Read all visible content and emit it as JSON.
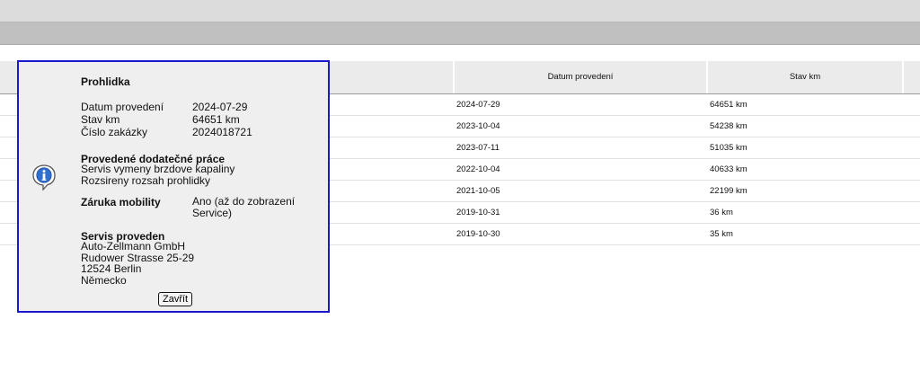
{
  "table": {
    "headers": {
      "a": "",
      "date": "Datum provedení",
      "km": "Stav km",
      "d": ""
    },
    "rows": [
      {
        "date": "2024-07-29",
        "km": "64651 km"
      },
      {
        "date": "2023-10-04",
        "km": "54238 km"
      },
      {
        "date": "2023-07-11",
        "km": "51035 km"
      },
      {
        "date": "2022-10-04",
        "km": "40633 km"
      },
      {
        "date": "2021-10-05",
        "km": "22199 km"
      },
      {
        "date": "2019-10-31",
        "km": "36 km"
      },
      {
        "date": "2019-10-30",
        "km": "35 km"
      }
    ]
  },
  "popup": {
    "title": "Prohlidka",
    "fields": [
      {
        "label": "Datum provedení",
        "value": "2024-07-29"
      },
      {
        "label": "Stav km",
        "value": "64651 km"
      },
      {
        "label": "Číslo zakázky",
        "value": "2024018721"
      }
    ],
    "extra_work_title": "Provedené dodatečné práce",
    "extra_work_lines": [
      "Servis vymeny brzdove kapaliny",
      "Rozsireny rozsah prohlidky"
    ],
    "mobility_label": "Záruka mobility",
    "mobility_value": "Ano (až do zobrazení Service)",
    "service_title": "Servis proveden",
    "service_lines": [
      "Auto-Zellmann GmbH",
      "Rudower Strasse 25-29",
      "12524 Berlin",
      "Německo"
    ],
    "close_label": "Zavřít",
    "icon": "info-icon",
    "border_color": "#1a1acc"
  }
}
